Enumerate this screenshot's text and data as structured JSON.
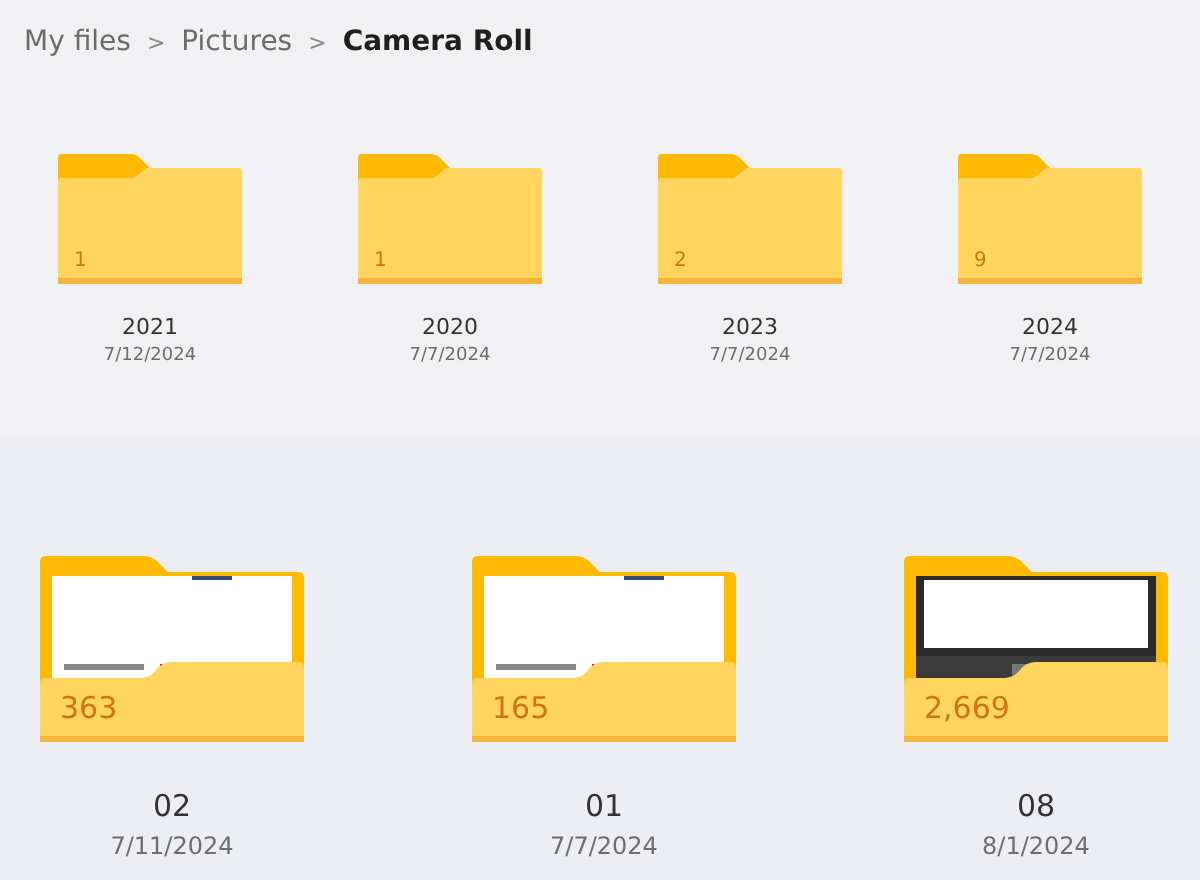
{
  "breadcrumb": [
    {
      "label": "My files",
      "current": false
    },
    {
      "label": "Pictures",
      "current": false
    },
    {
      "label": "Camera Roll",
      "current": true
    }
  ],
  "separator": ">",
  "folders": [
    {
      "name": "2021",
      "date": "7/12/2024",
      "count": "1"
    },
    {
      "name": "2020",
      "date": "7/7/2024",
      "count": "1"
    },
    {
      "name": "2023",
      "date": "7/7/2024",
      "count": "2"
    },
    {
      "name": "2024",
      "date": "7/7/2024",
      "count": "9"
    }
  ],
  "recent_folders": [
    {
      "name": "02",
      "date": "7/11/2024",
      "count": "363"
    },
    {
      "name": "01",
      "date": "7/7/2024",
      "count": "165"
    },
    {
      "name": "08",
      "date": "8/1/2024",
      "count": "2,669"
    }
  ]
}
